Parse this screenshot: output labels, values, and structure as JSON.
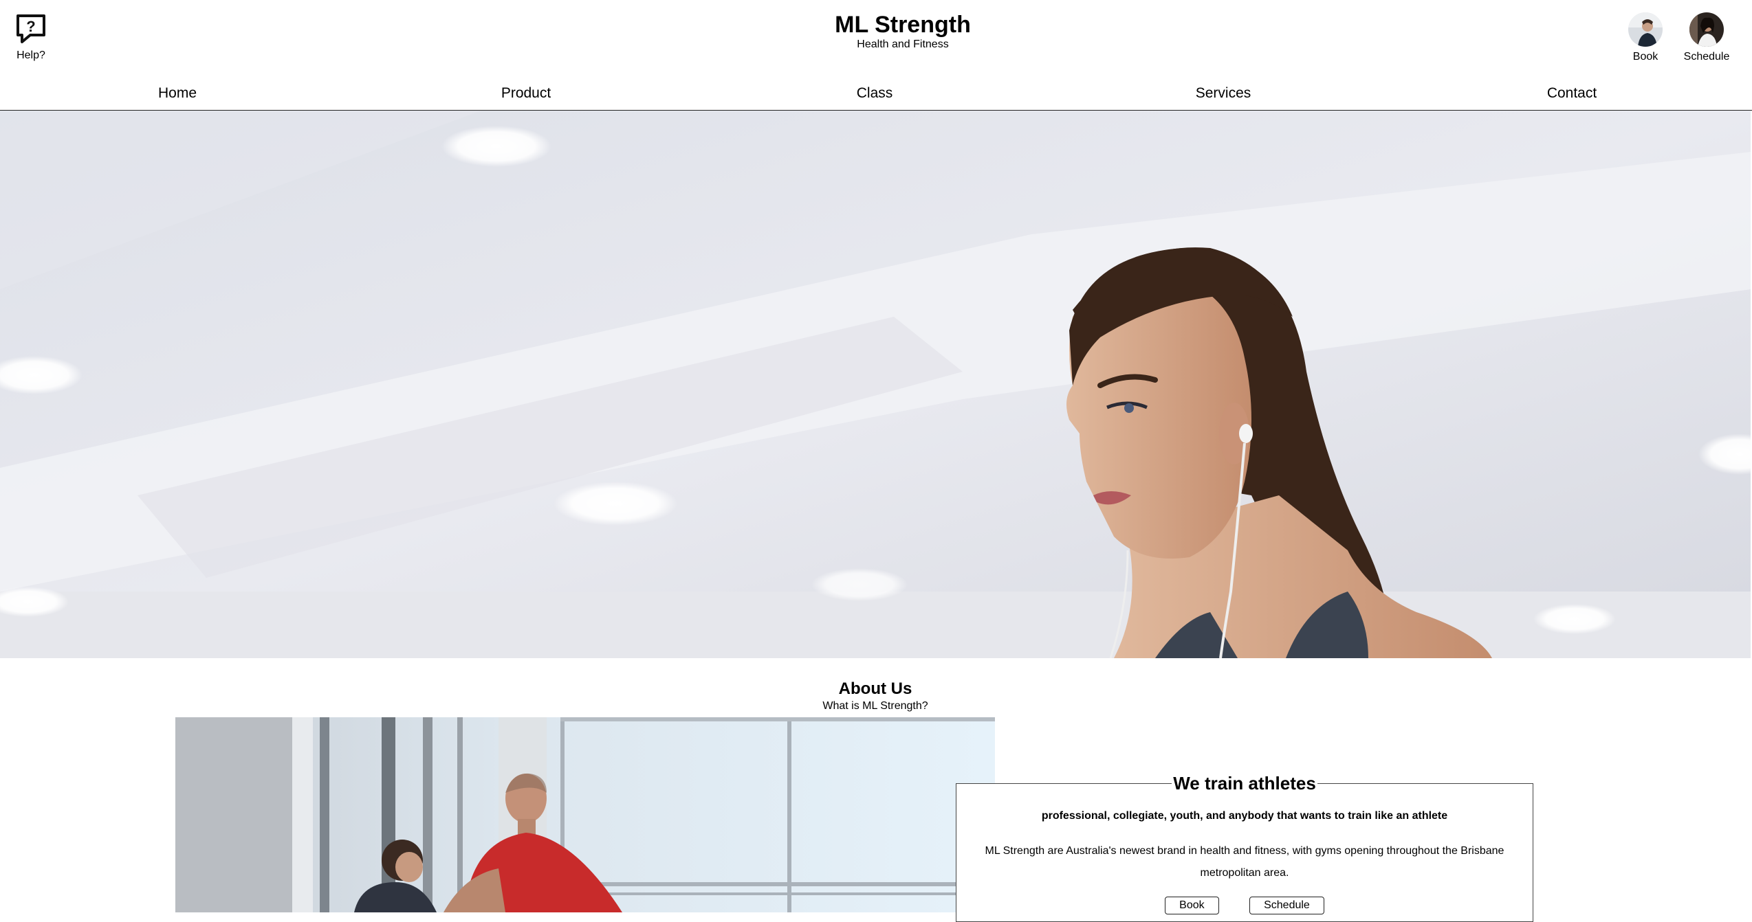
{
  "header": {
    "help_label": "Help?",
    "title": "ML Strength",
    "subtitle": "Health and Fitness",
    "quick_links": [
      {
        "label": "Book"
      },
      {
        "label": "Schedule"
      }
    ]
  },
  "nav": {
    "items": [
      {
        "label": "Home"
      },
      {
        "label": "Product"
      },
      {
        "label": "Class"
      },
      {
        "label": "Services"
      },
      {
        "label": "Contact"
      }
    ]
  },
  "about": {
    "title": "About Us",
    "subtitle": "What is ML Strength?",
    "box_title": "We train athletes",
    "tagline": "professional, collegiate, youth, and anybody that wants to train like an athlete",
    "body": "ML Strength are Australia's newest brand in health and fitness, with gyms opening throughout the Brisbane metropolitan area.",
    "buttons": [
      {
        "label": "Book"
      },
      {
        "label": "Schedule"
      }
    ]
  },
  "icons": {
    "help": "help-chat-icon"
  }
}
